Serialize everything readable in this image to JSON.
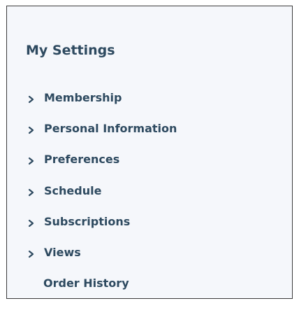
{
  "settings": {
    "title": "My Settings",
    "items": [
      {
        "label": "Membership",
        "icon": "chevron-right-icon"
      },
      {
        "label": "Personal Information",
        "icon": "chevron-right-icon"
      },
      {
        "label": "Preferences",
        "icon": "chevron-right-icon"
      },
      {
        "label": "Schedule",
        "icon": "chevron-right-icon"
      },
      {
        "label": "Subscriptions",
        "icon": "chevron-right-icon"
      },
      {
        "label": "Views",
        "icon": "chevron-right-icon"
      },
      {
        "label": "Order History"
      }
    ],
    "colors": {
      "text": "#2e4a60",
      "background": "#f5f7fb",
      "border": "#3a3a3a"
    }
  }
}
